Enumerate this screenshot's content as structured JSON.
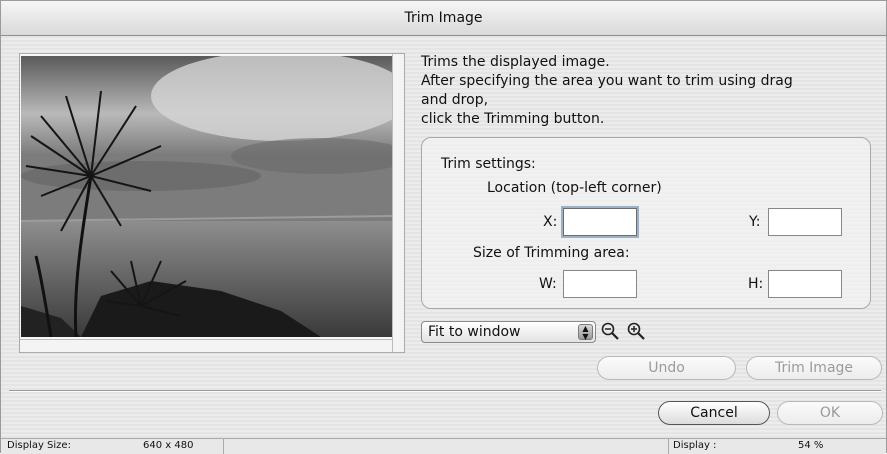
{
  "window": {
    "title": "Trim Image"
  },
  "instructions": "Trims the displayed image.\nAfter specifying the area you want to trim using drag\nand drop,\nclick the Trimming button.",
  "trim_settings": {
    "heading": "Trim settings:",
    "location_label": "Location (top-left corner)",
    "x_label": "X:",
    "y_label": "Y:",
    "size_label": "Size of Trimming area:",
    "w_label": "W:",
    "h_label": "H:",
    "x_value": "",
    "y_value": "",
    "w_value": "",
    "h_value": ""
  },
  "zoom_select": {
    "selected": "Fit to window"
  },
  "icons": {
    "zoom_out": "zoom-out-icon",
    "zoom_in": "zoom-in-icon",
    "select_arrows": "updown-arrows-icon"
  },
  "buttons": {
    "undo": "Undo",
    "trim": "Trim Image",
    "cancel": "Cancel",
    "ok": "OK"
  },
  "status": {
    "display_size_label": "Display Size:",
    "display_size_value": "640 x 480",
    "display_label": "Display :",
    "display_value": "54 %"
  }
}
